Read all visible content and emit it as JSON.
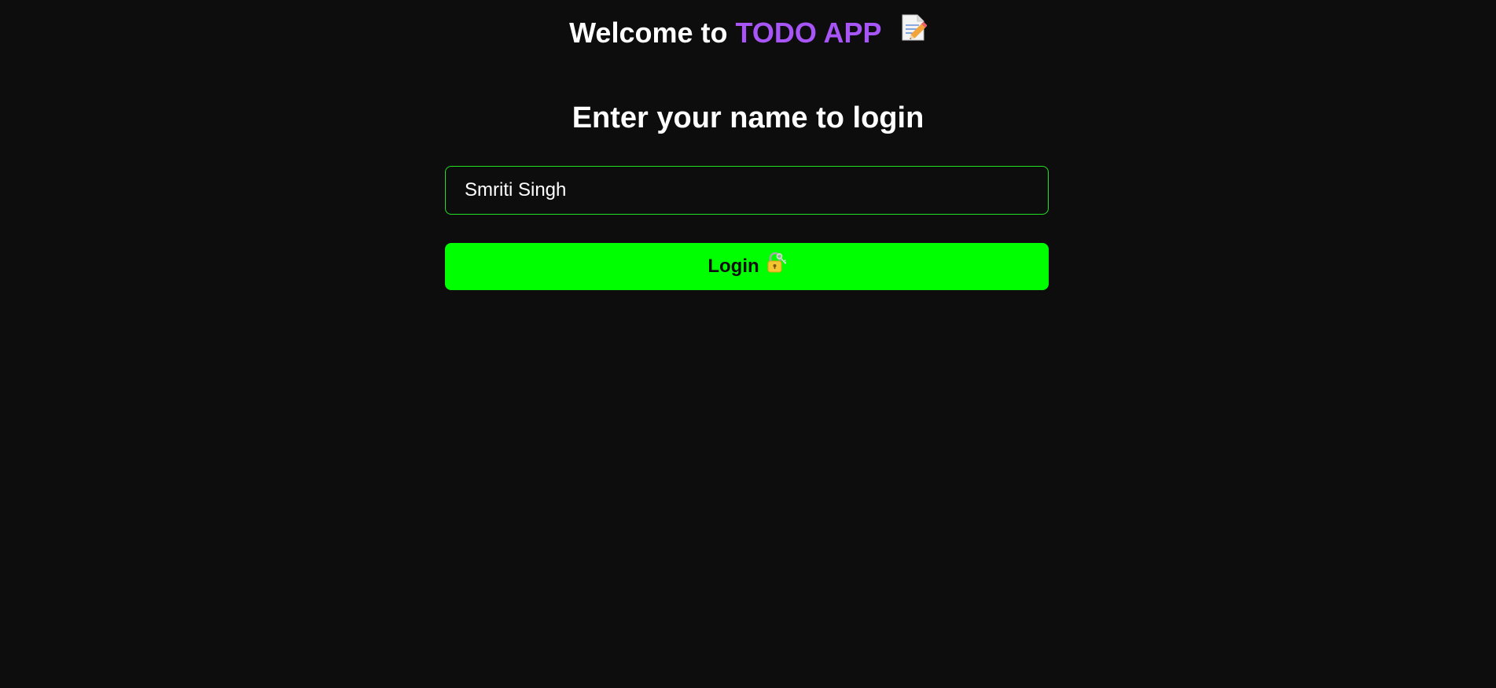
{
  "header": {
    "welcome_text": "Welcome to",
    "brand_name": "TODO APP",
    "icon": "memo-icon"
  },
  "login": {
    "heading": "Enter your name to login",
    "name_input_value": "Smriti Singh",
    "button_label": "Login",
    "button_icon": "lock-with-key-icon"
  },
  "colors": {
    "background": "#0d0d0d",
    "brand": "#a855f7",
    "accent": "#00ff00",
    "input_border": "#22e022"
  }
}
